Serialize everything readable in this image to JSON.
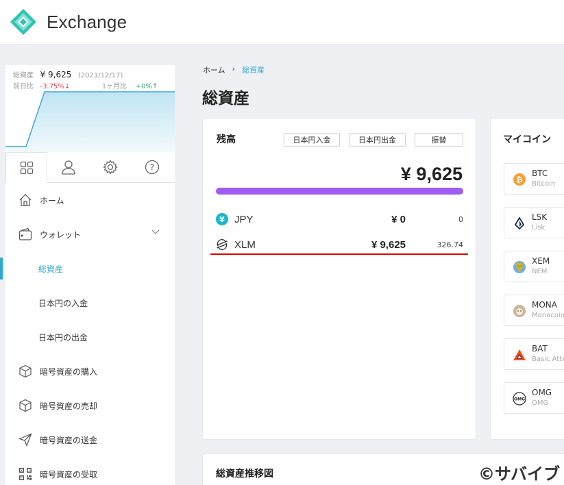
{
  "header": {
    "brand": "Exchange"
  },
  "summary": {
    "total_label": "総資産",
    "total_value": "¥ 9,625",
    "date": "(2021/12/17)",
    "prev_day_label": "前日比",
    "prev_day_value": "-3.75%",
    "prev_day_arrow": "↓",
    "month_label": "1ヶ月比",
    "month_value": "+0%",
    "month_arrow": "↑"
  },
  "tabs": [
    {
      "icon": "grid-icon"
    },
    {
      "icon": "user-icon"
    },
    {
      "icon": "gear-icon"
    },
    {
      "icon": "help-icon"
    }
  ],
  "nav": {
    "home": "ホーム",
    "wallet": "ウォレット",
    "total_assets": "総資産",
    "jpy_deposit": "日本円の入金",
    "jpy_withdraw": "日本円の出金",
    "buy": "暗号資産の購入",
    "sell": "暗号資産の売却",
    "send": "暗号資産の送金",
    "receive": "暗号資産の受取"
  },
  "breadcrumb": {
    "home": "ホーム",
    "sep": "›",
    "current": "総資産"
  },
  "page_title": "総資産",
  "balance": {
    "title": "残高",
    "btn_deposit": "日本円入金",
    "btn_withdraw": "日本円出金",
    "btn_transfer": "振替",
    "total": "¥ 9,625",
    "rows": [
      {
        "name": "JPY",
        "jpy": "¥ 0",
        "amount": "0"
      },
      {
        "name": "XLM",
        "jpy": "¥ 9,625",
        "amount": "326.74"
      }
    ]
  },
  "mycoins": {
    "title": "マイコイン",
    "items": [
      {
        "symbol": "BTC",
        "name": "Bitcoin"
      },
      {
        "symbol": "LSK",
        "name": "Lisk"
      },
      {
        "symbol": "XEM",
        "name": "NEM"
      },
      {
        "symbol": "MONA",
        "name": "Monacoin"
      },
      {
        "symbol": "BAT",
        "name": "Basic Atte"
      },
      {
        "symbol": "OMG",
        "name": "OMG"
      }
    ]
  },
  "chart_section": {
    "title": "総資産推移図"
  },
  "watermark": "©サバイブ",
  "colors": {
    "accent": "#2ea8cf",
    "bar": "#a05cf0",
    "down": "#e0364f",
    "up": "#2f9e6b"
  }
}
